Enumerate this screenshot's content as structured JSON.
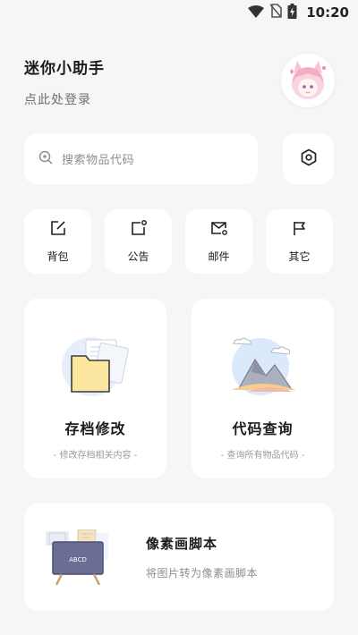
{
  "status_bar": {
    "time": "10:20",
    "icons": [
      "wifi-icon",
      "no-sim-icon",
      "battery-charging-icon"
    ]
  },
  "header": {
    "title": "迷你小助手",
    "login": "点此处登录"
  },
  "avatar": {
    "icon": "anime-avatar"
  },
  "search": {
    "placeholder": "搜索物品代码",
    "icon": "search-icon"
  },
  "settings": {
    "icon": "settings-hexagon-icon"
  },
  "quick_actions": [
    {
      "label": "背包",
      "icon": "edit-square-icon"
    },
    {
      "label": "公告",
      "icon": "notice-icon"
    },
    {
      "label": "邮件",
      "icon": "mail-icon"
    },
    {
      "label": "其它",
      "icon": "flag-icon"
    }
  ],
  "cards": [
    {
      "title": "存档修改",
      "subtitle": "- 修改存档相关内容 -",
      "icon": "folder-illustration"
    },
    {
      "title": "代码查询",
      "subtitle": "- 查询所有物品代码 -",
      "icon": "mountain-illustration"
    }
  ],
  "wide_card": {
    "title": "像素画脚本",
    "subtitle": "将图片转为像素画脚本",
    "board_text": "ABCD",
    "icon": "blackboard-illustration"
  },
  "colors": {
    "background": "#f6f6f8",
    "card": "#ffffff",
    "folder": "#fbe6a0",
    "board": "#6b6f96"
  }
}
